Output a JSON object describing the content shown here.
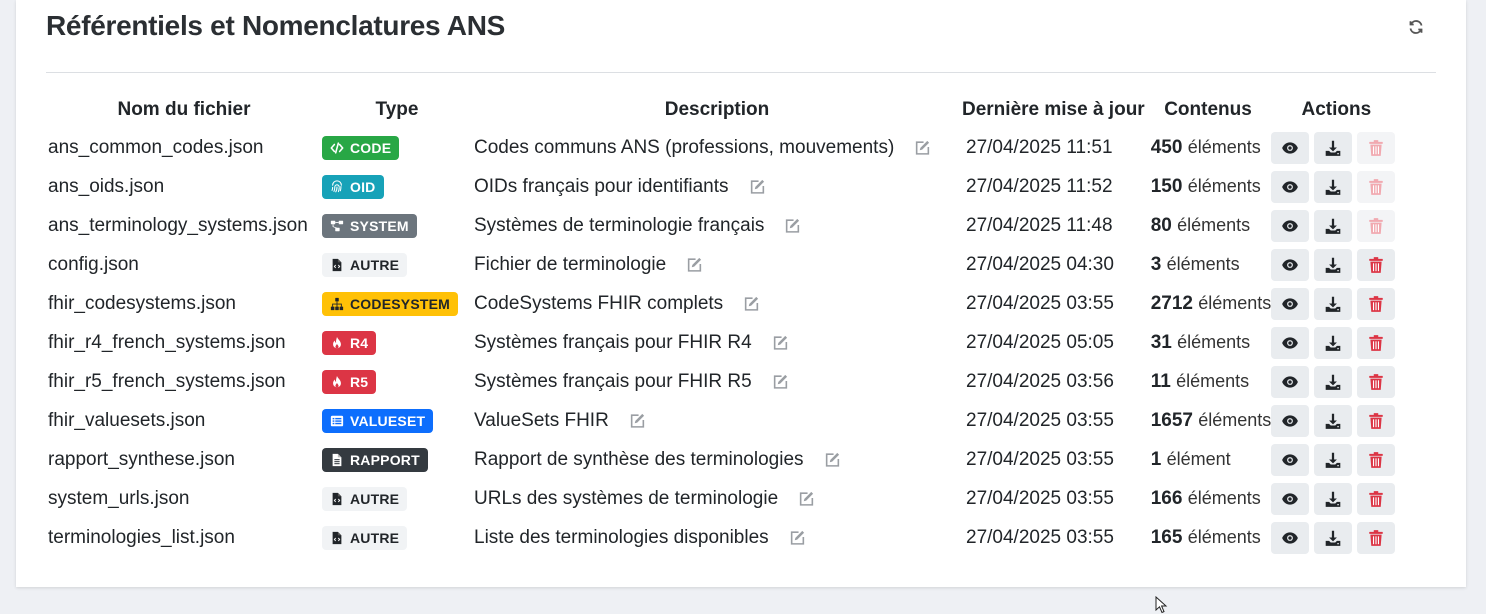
{
  "title": "Référentiels et Nomenclatures ANS",
  "columns": {
    "filename": "Nom du fichier",
    "type": "Type",
    "description": "Description",
    "updated": "Dernière mise à jour",
    "content": "Contenus",
    "actions": "Actions"
  },
  "type_colors": {
    "CODE": "#28a745",
    "OID": "#17a2b8",
    "SYSTEM": "#6c757d",
    "AUTRE": "#f1f3f5",
    "CODESYSTEM": "#ffc107",
    "R4": "#dc3545",
    "R5": "#dc3545",
    "VALUESET": "#0d6efd",
    "RAPPORT": "#343a40"
  },
  "rows": [
    {
      "filename": "ans_common_codes.json",
      "type": "CODE",
      "type_icon": "code-icon",
      "description": "Codes communs ANS (professions, mouvements)",
      "updated": "27/04/2025 11:51",
      "count": "450",
      "unit": "éléments",
      "delete_disabled": true
    },
    {
      "filename": "ans_oids.json",
      "type": "OID",
      "type_icon": "fingerprint-icon",
      "description": "OIDs français pour identifiants",
      "updated": "27/04/2025 11:52",
      "count": "150",
      "unit": "éléments",
      "delete_disabled": true
    },
    {
      "filename": "ans_terminology_systems.json",
      "type": "SYSTEM",
      "type_icon": "project-diagram-icon",
      "description": "Systèmes de terminologie français",
      "updated": "27/04/2025 11:48",
      "count": "80",
      "unit": "éléments",
      "delete_disabled": true
    },
    {
      "filename": "config.json",
      "type": "AUTRE",
      "type_icon": "file-code-icon",
      "description": "Fichier de terminologie",
      "updated": "27/04/2025 04:30",
      "count": "3",
      "unit": "éléments",
      "delete_disabled": false
    },
    {
      "filename": "fhir_codesystems.json",
      "type": "CODESYSTEM",
      "type_icon": "sitemap-icon",
      "description": "CodeSystems FHIR complets",
      "updated": "27/04/2025 03:55",
      "count": "2712",
      "unit": "éléments",
      "delete_disabled": false
    },
    {
      "filename": "fhir_r4_french_systems.json",
      "type": "R4",
      "type_icon": "fire-icon",
      "description": "Systèmes français pour FHIR R4",
      "updated": "27/04/2025 05:05",
      "count": "31",
      "unit": "éléments",
      "delete_disabled": false
    },
    {
      "filename": "fhir_r5_french_systems.json",
      "type": "R5",
      "type_icon": "fire-icon",
      "description": "Systèmes français pour FHIR R5",
      "updated": "27/04/2025 03:56",
      "count": "11",
      "unit": "éléments",
      "delete_disabled": false
    },
    {
      "filename": "fhir_valuesets.json",
      "type": "VALUESET",
      "type_icon": "list-alt-icon",
      "description": "ValueSets FHIR",
      "updated": "27/04/2025 03:55",
      "count": "1657",
      "unit": "éléments",
      "delete_disabled": false
    },
    {
      "filename": "rapport_synthese.json",
      "type": "RAPPORT",
      "type_icon": "file-alt-icon",
      "description": "Rapport de synthèse des terminologies",
      "updated": "27/04/2025 03:55",
      "count": "1",
      "unit": "élément",
      "delete_disabled": false
    },
    {
      "filename": "system_urls.json",
      "type": "AUTRE",
      "type_icon": "file-code-icon",
      "description": "URLs des systèmes de terminologie",
      "updated": "27/04/2025 03:55",
      "count": "166",
      "unit": "éléments",
      "delete_disabled": false
    },
    {
      "filename": "terminologies_list.json",
      "type": "AUTRE",
      "type_icon": "file-code-icon",
      "description": "Liste des terminologies disponibles",
      "updated": "27/04/2025 03:55",
      "count": "165",
      "unit": "éléments",
      "delete_disabled": false
    }
  ]
}
